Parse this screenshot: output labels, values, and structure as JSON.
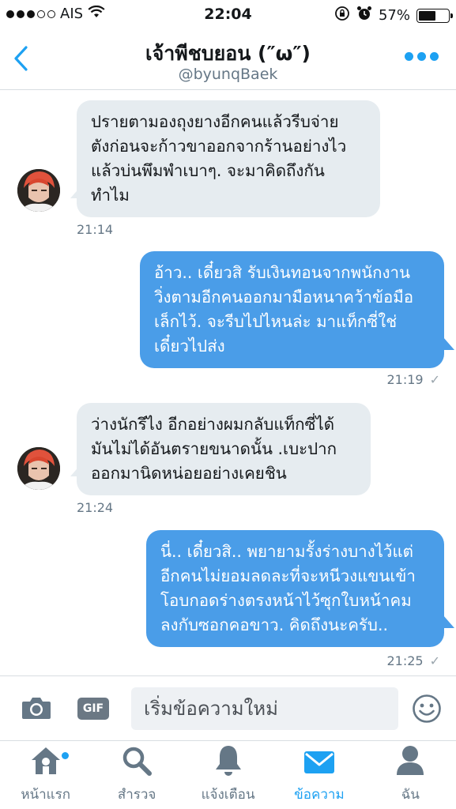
{
  "status_bar": {
    "carrier": "AIS",
    "time": "22:04",
    "battery": "57%",
    "battery_level": 0.57
  },
  "header": {
    "title": "เจ้าพีชบยอน (″ω″)",
    "handle": "@byunqBaek"
  },
  "messages": [
    {
      "direction": "incoming",
      "lines": [
        "ปรายตามองถุงยางอีกคนแล้วรีบจ่าย",
        "ตังก่อนจะก้าวขาออกจากร้านอย่างไว",
        "แล้วบ่นพึมพำเบาๆ. จะมาคิดถึงกัน",
        "ทำไม"
      ],
      "time": "21:14"
    },
    {
      "direction": "outgoing",
      "lines": [
        "อ้าว.. เดี๋ยวสิ รับเงินทอนจากพนักงาน",
        "วิ่งตามอีกคนออกมามือหนาคว้าข้อมือ",
        "เล็กไว้. จะรีบไปไหนล่ะ มาแท็กซี่ใช่",
        "เดี๋ยวไปส่ง"
      ],
      "time": "21:19"
    },
    {
      "direction": "incoming",
      "lines": [
        "ว่างนักรึไง อีกอย่างผมกลับแท็กซี่ได้",
        "มันไม่ได้อันตรายขนาดนั้น .เบะปาก",
        "ออกมานิดหน่อยอย่างเคยชิน"
      ],
      "time": "21:24"
    },
    {
      "direction": "outgoing",
      "lines": [
        "นี่.. เดี๋ยวสิ.. พยายามรั้งร่างบางไว้แต่",
        "อีกคนไม่ยอมลดละที่จะหนีวงแขนเข้า",
        "โอบกอดร่างตรงหน้าไว้ซุกใบหน้าคม",
        "ลงกับซอกคอขาว. คิดถึงนะครับ.."
      ],
      "time": "21:25"
    }
  ],
  "read_check": "✓",
  "composer": {
    "gif_label": "GIF",
    "placeholder": "เริ่มข้อความใหม่"
  },
  "tabs": [
    {
      "label": "หน้าแรก",
      "icon": "home-icon",
      "active": false
    },
    {
      "label": "สำรวจ",
      "icon": "search-icon",
      "active": false
    },
    {
      "label": "แจ้งเตือน",
      "icon": "bell-icon",
      "active": false
    },
    {
      "label": "ข้อความ",
      "icon": "envelope-icon",
      "active": true
    },
    {
      "label": "ฉัน",
      "icon": "profile-icon",
      "active": false
    }
  ],
  "colors": {
    "accent": "#1da1f2",
    "outgoing_bubble": "#4a9de8",
    "incoming_bubble": "#e6ecf0"
  }
}
